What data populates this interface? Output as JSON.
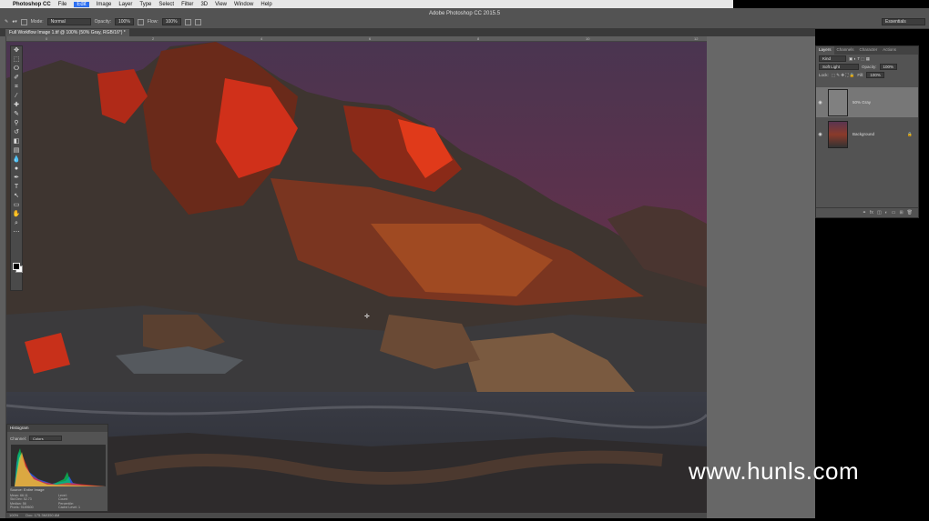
{
  "menubar": {
    "apple": "",
    "app": "Photoshop CC",
    "items": [
      "File",
      "Edit",
      "Image",
      "Layer",
      "Type",
      "Select",
      "Filter",
      "3D",
      "View",
      "Window",
      "Help"
    ],
    "active": "Edit"
  },
  "window": {
    "title": "Adobe Photoshop CC 2015.5"
  },
  "options": {
    "mode_label": "Mode:",
    "mode_value": "Normal",
    "opacity_label": "Opacity:",
    "opacity_value": "100%",
    "flow_label": "Flow:",
    "flow_value": "100%"
  },
  "workspace": "Essentials",
  "document_tab": "Full Workflow Image 1.tif @ 100% (50% Gray, RGB/16*) *",
  "ruler_ticks": [
    "0",
    "2",
    "4",
    "6",
    "8",
    "10",
    "12",
    "14"
  ],
  "layers_panel": {
    "tabs": [
      "Layers",
      "Channels",
      "Character",
      "Actions"
    ],
    "active_tab": "Layers",
    "filter": "Kind",
    "blend_mode": "Soft Light",
    "opacity_label": "Opacity:",
    "opacity_value": "100%",
    "lock_label": "Lock:",
    "fill_label": "Fill:",
    "fill_value": "100%",
    "layers": [
      {
        "name": "50% Gray",
        "selected": true
      },
      {
        "name": "Background",
        "selected": false
      }
    ]
  },
  "histogram": {
    "title": "Histogram",
    "channel_label": "Channel:",
    "channel_value": "Colors",
    "source_label": "Source:",
    "source_value": "Entire Image",
    "stats": [
      "Mean: 66.11",
      "Level:",
      "Std Dev: 52.73",
      "Count:",
      "Median: 56",
      "Percentile:",
      "Pixels: 9189600",
      "Cache Level: 1"
    ]
  },
  "status": {
    "zoom": "100%",
    "doc": "Doc: 175.3M/350.6M"
  },
  "watermark": "www.hunls.com",
  "colors": {
    "ui_dark": "#535353",
    "accent": "#2d6ff0",
    "sky": "#5a2f4c"
  }
}
